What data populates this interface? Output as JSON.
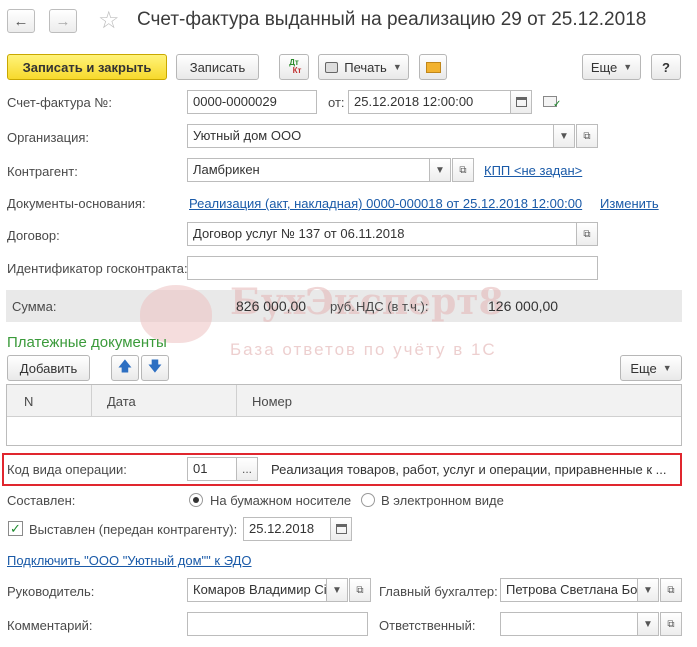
{
  "window": {
    "title": "Счет-фактура выданный на реализацию 29 от 25.12.2018"
  },
  "toolbar": {
    "save_close_label": "Записать и закрыть",
    "save_label": "Записать",
    "dt_kt_label": "Дт Кт",
    "print_label": "Печать",
    "more_label": "Еще",
    "help_label": "?"
  },
  "form": {
    "invoice_no_label": "Счет-фактура №:",
    "invoice_no_value": "0000-0000029",
    "from_label": "от:",
    "from_value": "25.12.2018 12:00:00",
    "org_label": "Организация:",
    "org_value": "Уютный дом ООО",
    "counterparty_label": "Контрагент:",
    "counterparty_value": "Ламбрикен",
    "kpp_link": "КПП <не задан>",
    "basis_label": "Документы-основания:",
    "basis_link": "Реализация (акт, накладная) 0000-000018 от 25.12.2018 12:00:00",
    "change_link": "Изменить",
    "contract_label": "Договор:",
    "contract_value": "Договор услуг № 137 от 06.11.2018",
    "gov_contract_label": "Идентификатор госконтракта:",
    "gov_contract_value": "",
    "sum_label": "Сумма:",
    "sum_value": "826 000,00",
    "currency": "руб.",
    "vat_label": "НДС (в т.ч.):",
    "vat_value": "126 000,00"
  },
  "payments": {
    "title": "Платежные документы",
    "add_label": "Добавить",
    "more_label": "Еще",
    "columns": [
      "N",
      "Дата",
      "Номер"
    ],
    "rows": []
  },
  "operation": {
    "label": "Код вида операции:",
    "code": "01",
    "select_label": "...",
    "description": "Реализация товаров, работ, услуг и операции, приравненные к ..."
  },
  "composed": {
    "label": "Составлен:",
    "option_paper": "На бумажном носителе",
    "option_electronic": "В электронном виде",
    "selected": "paper"
  },
  "issued": {
    "checked": true,
    "label": "Выставлен (передан контрагенту):",
    "date": "25.12.2018"
  },
  "edo_link": "Подключить \"ООО \"Уютный дом\"\" к ЭДО",
  "signatures": {
    "head_label": "Руководитель:",
    "head_value": "Комаров Владимир Сі",
    "accountant_label": "Главный бухгалтер:",
    "accountant_value": "Петрова Светлана Бор",
    "comment_label": "Комментарий:",
    "comment_value": "",
    "responsible_label": "Ответственный:",
    "responsible_value": ""
  },
  "watermark": {
    "brand": "БухЭксперт8",
    "tagline": "База ответов по учёту в 1С"
  },
  "colors": {
    "primary_button": "#f7d92c",
    "link": "#1a5aa8",
    "section_title": "#3a9a3a",
    "highlight_border": "#e0262e"
  }
}
